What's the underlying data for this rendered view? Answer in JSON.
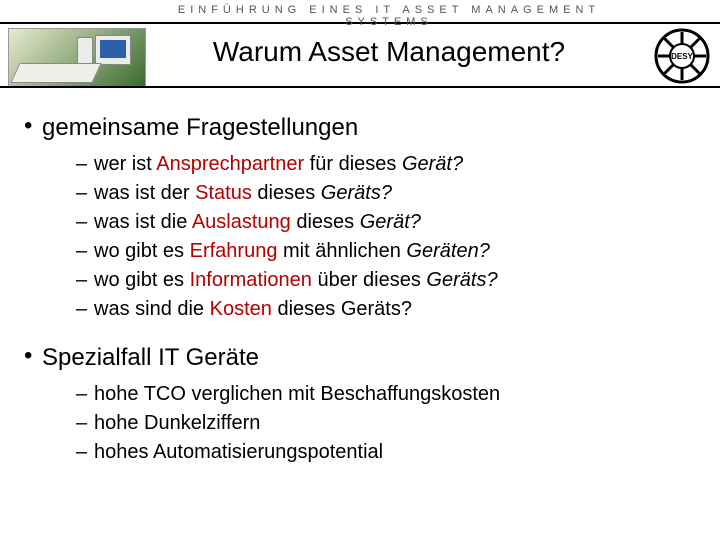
{
  "header": {
    "eyebrow": "EINFÜHRUNG EINES IT ASSET MANAGEMENT SYSTEMS",
    "title": "Warum Asset Management?",
    "logo_text": "DESY"
  },
  "sections": [
    {
      "heading": "gemeinsame Fragestellungen",
      "items": [
        {
          "pre": "wer ist ",
          "hl": "Ansprechpartner",
          "post": " für dieses ",
          "it": "Gerät?",
          "it_color": false
        },
        {
          "pre": "was ist der ",
          "hl": "Status",
          "post": " dieses ",
          "it": "Geräts?",
          "it_color": false
        },
        {
          "pre": "was ist die ",
          "hl": "Auslastung",
          "post": " dieses ",
          "it": "Gerät?",
          "it_color": false
        },
        {
          "pre": "wo gibt es ",
          "hl": "Erfahrung",
          "post": " mit ähnlichen ",
          "it": "Geräten?",
          "it_color": false
        },
        {
          "pre": "wo gibt es ",
          "hl": "Informationen",
          "post": " über dieses ",
          "it": "Geräts?",
          "it_color": false
        },
        {
          "pre": "was sind die ",
          "hl": "Kosten",
          "post": " dieses Geräts?",
          "it": "",
          "it_color": false
        }
      ]
    },
    {
      "heading": "Spezialfall IT Geräte",
      "items": [
        {
          "plain": "hohe TCO verglichen mit Beschaffungskosten"
        },
        {
          "plain": "hohe Dunkelziffern"
        },
        {
          "plain": "hohes Automatisierungspotential"
        }
      ]
    }
  ]
}
